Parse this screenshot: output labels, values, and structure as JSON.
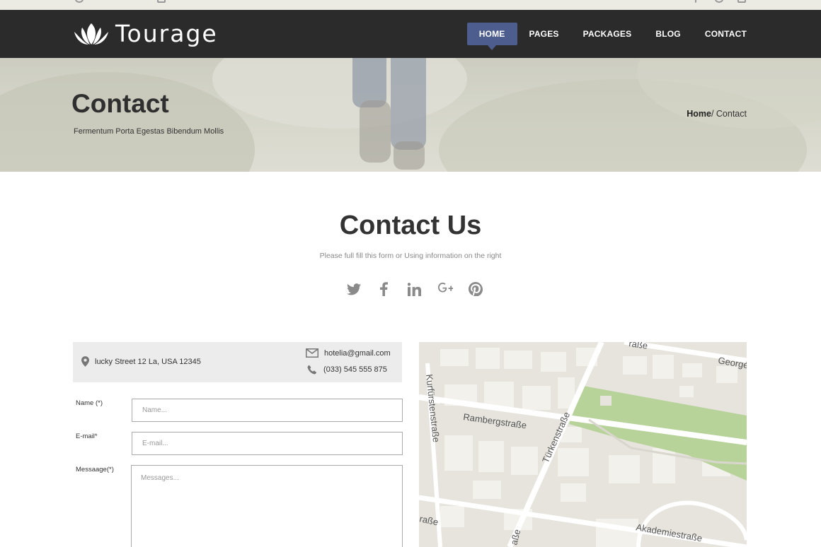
{
  "brand": {
    "name": "Tourage"
  },
  "nav": {
    "items": [
      {
        "label": "HOME",
        "active": true
      },
      {
        "label": "PAGES",
        "active": false
      },
      {
        "label": "PACKAGES",
        "active": false
      },
      {
        "label": "BLOG",
        "active": false
      },
      {
        "label": "CONTACT",
        "active": false
      }
    ],
    "active_color": "#4d5e8e"
  },
  "banner": {
    "title": "Contact",
    "subtitle": "Fermentum Porta Egestas Bibendum Mollis",
    "breadcrumb": {
      "home": "Home",
      "separator": "/ ",
      "current": "Contact"
    }
  },
  "contact_section": {
    "title": "Contact Us",
    "subtitle": "Please full fill this form or Using information on the right",
    "social_icons": [
      "twitter-icon",
      "facebook-icon",
      "linkedin-icon",
      "google-plus-icon",
      "pinterest-icon"
    ]
  },
  "info": {
    "address": "lucky Street 12 La, USA 12345",
    "email": "hotelia@gmail.com",
    "phone": "(033) 545 555 875"
  },
  "form": {
    "name_label": "Name (*)",
    "name_placeholder": "Name...",
    "email_label": "E-mail*",
    "email_placeholder": "E-mail...",
    "message_label": "Messaage(*)",
    "message_placeholder": "Messages..."
  },
  "map": {
    "streets": [
      "Georgé",
      "Rambergstraße",
      "Kurfürstenstraße",
      "Türkenstraße",
      "Akademiestraße",
      "raße",
      "raße",
      "aße",
      "ße"
    ]
  }
}
